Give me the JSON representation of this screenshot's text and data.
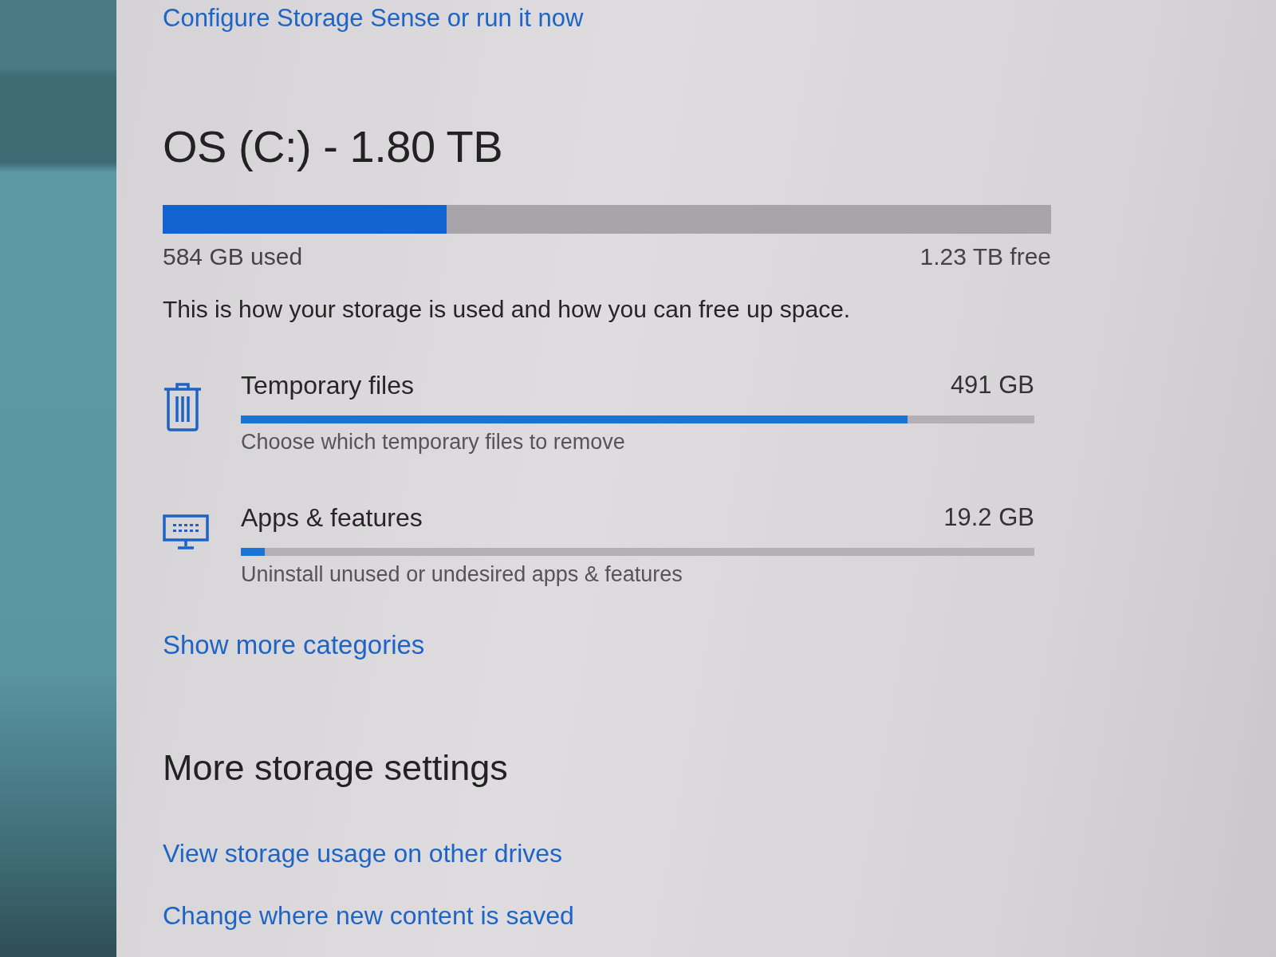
{
  "storage_sense_link": "Configure Storage Sense or run it now",
  "drive": {
    "title": "OS (C:) - 1.80 TB",
    "level": 0.32,
    "used": "584 GB used",
    "free": "1.23 TB free"
  },
  "description": "This is how your storage is used and how you can free up space.",
  "categories": [
    {
      "kind": "trash",
      "name": "Temporary files",
      "size": "491 GB",
      "level": 0.84,
      "hint": "Choose which temporary files to remove"
    },
    {
      "kind": "apps",
      "name": "Apps & features",
      "size": "19.2 GB",
      "level": 0.03,
      "hint": "Uninstall unused or undesired apps & features"
    }
  ],
  "show_more_link": "Show more categories",
  "more_settings": {
    "heading": "More storage settings",
    "links": [
      "View storage usage on other drives",
      "Change where new content is saved"
    ]
  }
}
